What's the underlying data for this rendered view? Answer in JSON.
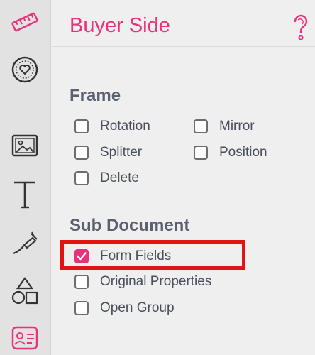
{
  "app": {
    "accent_color": "#e8327a",
    "highlight_color": "#e01414"
  },
  "toolbar": {
    "tools": [
      {
        "icon": "ruler-icon"
      },
      {
        "icon": "heart-badge-icon"
      },
      {
        "icon": "image-icon"
      },
      {
        "icon": "text-icon"
      },
      {
        "icon": "signature-pen-icon"
      },
      {
        "icon": "shapes-icon"
      },
      {
        "icon": "contact-card-icon"
      }
    ]
  },
  "panel": {
    "title": "Buyer Side",
    "help_icon": "help-icon",
    "frame": {
      "heading": "Frame",
      "options": [
        {
          "label": "Rotation",
          "checked": false
        },
        {
          "label": "Mirror",
          "checked": false
        },
        {
          "label": "Splitter",
          "checked": false
        },
        {
          "label": "Position",
          "checked": false
        },
        {
          "label": "Delete",
          "checked": false
        }
      ]
    },
    "sub_document": {
      "heading": "Sub Document",
      "options": [
        {
          "label": "Form Fields",
          "checked": true
        },
        {
          "label": "Original Properties",
          "checked": false
        },
        {
          "label": "Open Group",
          "checked": false
        }
      ]
    }
  }
}
